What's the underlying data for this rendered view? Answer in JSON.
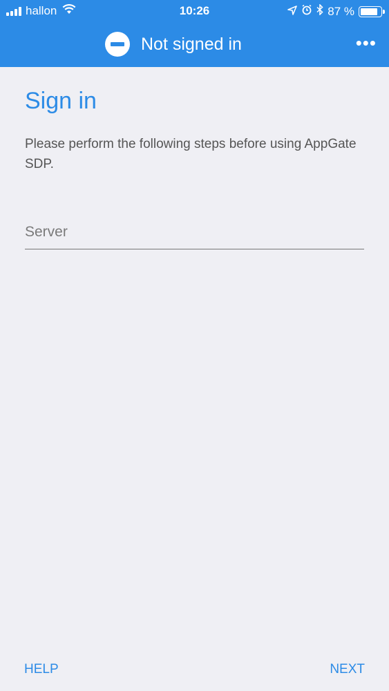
{
  "status_bar": {
    "carrier": "hallon",
    "time": "10:26",
    "battery": "87 %",
    "battery_level": 0.87,
    "icons": [
      "signal-bars-icon",
      "wifi-icon",
      "location-arrow-icon",
      "alarm-icon",
      "bluetooth-icon",
      "battery-icon"
    ]
  },
  "header": {
    "status_icon": "no-entry-icon",
    "title": "Not signed in",
    "more_icon": "more-horizontal-icon",
    "more_label": "•••"
  },
  "main": {
    "heading": "Sign in",
    "description": "Please perform the following steps before using AppGate SDP.",
    "server_field": {
      "placeholder": "Server",
      "value": ""
    }
  },
  "footer": {
    "help_label": "HELP",
    "next_label": "NEXT"
  },
  "colors": {
    "accent": "#2c8be6",
    "background": "#efeff4"
  }
}
